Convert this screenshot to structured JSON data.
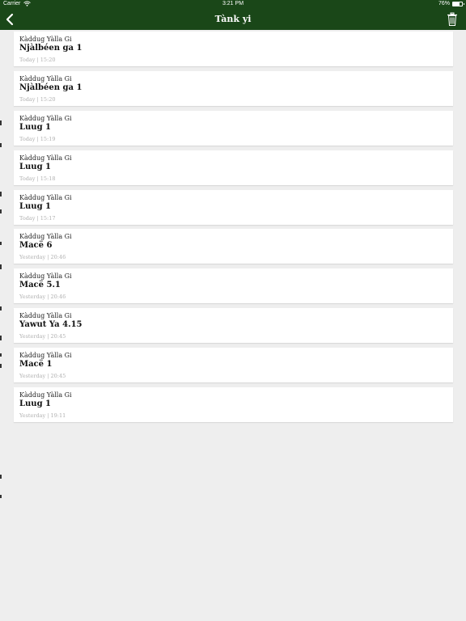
{
  "status_bar": {
    "carrier": "Carrier",
    "time": "3:21 PM",
    "battery": "76%",
    "battery_level": 0.76,
    "wifi_icon": "wifi-icon",
    "battery_icon": "battery-icon"
  },
  "nav": {
    "title": "Tànk yi",
    "back_icon": "chevron-left-icon",
    "trash_icon": "trash-icon"
  },
  "colors": {
    "header": "#1a4718",
    "background": "#eeeeee",
    "card": "#ffffff",
    "timestamp": "#b0b0b0"
  },
  "bookmarks": [
    {
      "source": "Kàddug Yàlla Gi",
      "reference": "Njàlbéen ga 1",
      "day": "Today",
      "time": "15:20"
    },
    {
      "source": "Kàddug Yàlla Gi",
      "reference": "Njàlbéen ga 1",
      "day": "Today",
      "time": "15:20"
    },
    {
      "source": "Kàddug Yàlla Gi",
      "reference": "Luug 1",
      "day": "Today",
      "time": "15:19"
    },
    {
      "source": "Kàddug Yàlla Gi",
      "reference": "Luug 1",
      "day": "Today",
      "time": "15:18"
    },
    {
      "source": "Kàddug Yàlla Gi",
      "reference": "Luug 1",
      "day": "Today",
      "time": "15:17"
    },
    {
      "source": "Kàddug Yàlla Gi",
      "reference": "Macë 6",
      "day": "Yesterday",
      "time": "20:46"
    },
    {
      "source": "Kàddug Yàlla Gi",
      "reference": "Macë 5.1",
      "day": "Yesterday",
      "time": "20:46"
    },
    {
      "source": "Kàddug Yàlla Gi",
      "reference": "Yawut Ya 4.15",
      "day": "Yesterday",
      "time": "20:45"
    },
    {
      "source": "Kàddug Yàlla Gi",
      "reference": "Macë 1",
      "day": "Yesterday",
      "time": "20:45"
    },
    {
      "source": "Kàddug Yàlla Gi",
      "reference": "Luug 1",
      "day": "Yesterday",
      "time": "19:11"
    }
  ]
}
